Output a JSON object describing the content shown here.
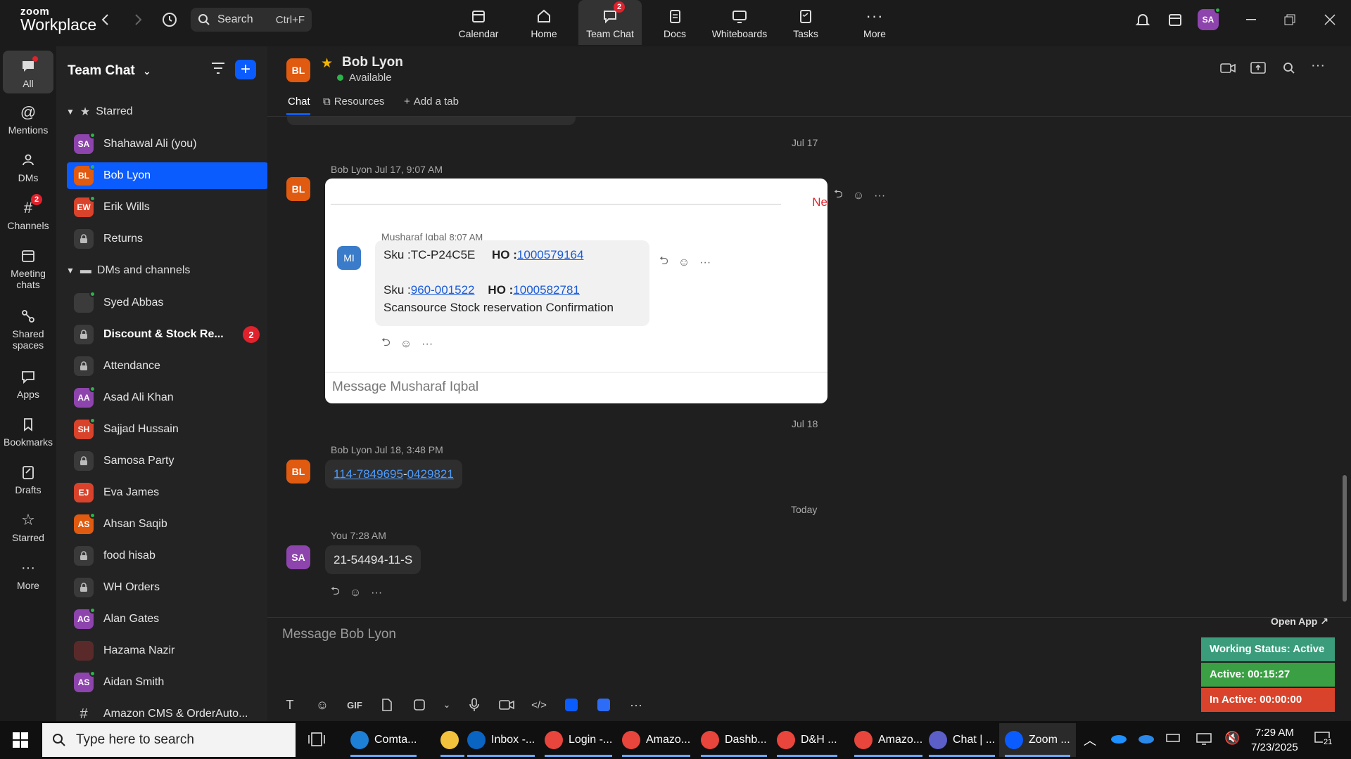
{
  "app": {
    "logo_top": "zoom",
    "logo_bottom": "Workplace"
  },
  "search": {
    "label": "Search",
    "shortcut": "Ctrl+F"
  },
  "topnav": [
    {
      "label": "Calendar",
      "icon": "calendar-icon"
    },
    {
      "label": "Home",
      "icon": "home-icon"
    },
    {
      "label": "Team Chat",
      "icon": "chat-icon",
      "badge": "2",
      "active": true
    },
    {
      "label": "Docs",
      "icon": "docs-icon"
    },
    {
      "label": "Whiteboards",
      "icon": "whiteboard-icon"
    },
    {
      "label": "Tasks",
      "icon": "tasks-icon"
    },
    {
      "label": "More",
      "icon": "more-icon"
    }
  ],
  "user_avatar": "SA",
  "rail": [
    {
      "label": "All",
      "icon": "chat-bubble-icon",
      "active": true
    },
    {
      "label": "Mentions",
      "icon": "at-icon"
    },
    {
      "label": "DMs",
      "icon": "people-icon"
    },
    {
      "label": "Channels",
      "icon": "hash-icon",
      "badge": "2"
    },
    {
      "label": "Meeting chats",
      "icon": "calendar-icon"
    },
    {
      "label": "Shared spaces",
      "icon": "shared-icon"
    },
    {
      "label": "Apps",
      "icon": "apps-icon"
    },
    {
      "label": "Bookmarks",
      "icon": "bookmark-icon"
    },
    {
      "label": "Drafts",
      "icon": "draft-icon"
    },
    {
      "label": "Starred",
      "icon": "star-icon"
    },
    {
      "label": "More",
      "icon": "more-icon"
    }
  ],
  "sidebar": {
    "title": "Team Chat",
    "starred_label": "Starred",
    "dms_label": "DMs and channels",
    "starred": [
      {
        "initials": "SA",
        "name": "Shahawal Ali (you)",
        "color": "#8e44ad",
        "online": true
      },
      {
        "initials": "BL",
        "name": "Bob Lyon",
        "color": "#e05a10",
        "online": true,
        "selected": true
      },
      {
        "initials": "EW",
        "name": "Erik Wills",
        "color": "#d9432b",
        "online": true
      },
      {
        "lock": true,
        "name": "Returns"
      }
    ],
    "items": [
      {
        "initials": "",
        "name": "Syed Abbas",
        "color": "#3b3b3b",
        "online": true,
        "photo": true
      },
      {
        "lock": true,
        "name": "Discount & Stock Re...",
        "bold": true,
        "badge": "2"
      },
      {
        "lock": true,
        "name": "Attendance"
      },
      {
        "initials": "AA",
        "name": "Asad Ali Khan",
        "color": "#8e44ad",
        "online": true
      },
      {
        "initials": "SH",
        "name": "Sajjad Hussain",
        "color": "#d9432b",
        "online": true
      },
      {
        "lock": true,
        "name": "Samosa Party"
      },
      {
        "initials": "EJ",
        "name": "Eva James",
        "color": "#d9432b"
      },
      {
        "initials": "AS",
        "name": "Ahsan Saqib",
        "color": "#e05a10",
        "online": true
      },
      {
        "lock": true,
        "name": "food hisab"
      },
      {
        "lock": true,
        "name": "WH Orders"
      },
      {
        "initials": "AG",
        "name": "Alan Gates",
        "color": "#8e44ad",
        "online": true
      },
      {
        "initials": "",
        "name": "Hazama Nazir",
        "color": "#5a2a2a",
        "photo": true
      },
      {
        "initials": "AS",
        "name": "Aidan Smith",
        "color": "#8e44ad",
        "online": true
      },
      {
        "hash": true,
        "name": "Amazon CMS & OrderAuto..."
      }
    ]
  },
  "chat": {
    "header": {
      "initials": "BL",
      "name": "Bob Lyon",
      "status": "Available"
    },
    "tabs": {
      "chat": "Chat",
      "resources": "Resources",
      "add": "Add a tab"
    },
    "date_jul17": "Jul 17",
    "date_jul18": "Jul 18",
    "date_today": "Today",
    "msg1": {
      "meta": "Bob Lyon Jul 17, 9:07 AM",
      "avatar": "BL",
      "card": {
        "new_label": "Ne",
        "inner_meta_name": "Musharaf Iqbal",
        "inner_meta_time": "8:07 AM",
        "avatar": "MI",
        "sku1_label": "Sku :TC-P24C5E",
        "ho_label": "HO :",
        "ho1": "1000579164",
        "sku2_prefix": "Sku :",
        "sku2": "960-001522",
        "ho2": "1000582781",
        "line3": "Scansource Stock reservation Confirmation",
        "placeholder": "Message Musharaf Iqbal"
      }
    },
    "msg2": {
      "meta": "Bob Lyon Jul 18, 3:48 PM",
      "avatar": "BL",
      "link_a": "114-7849695",
      "dash": "-",
      "link_b": "0429821"
    },
    "msg3": {
      "meta": "You 7:28 AM",
      "avatar": "SA",
      "text": "21-54494-11-S"
    },
    "compose_placeholder": "Message Bob Lyon",
    "toolbar_gif": "GIF"
  },
  "status_widget": {
    "open_app": "Open App ↗",
    "working": "Working Status: Active",
    "active": "Active: 00:15:27",
    "inactive": "In Active: 00:00:00",
    "colors": {
      "working": "#3a9c7a",
      "active": "#3aa043",
      "inactive": "#d9432b"
    }
  },
  "taskbar": {
    "search_placeholder": "Type here to search",
    "apps": [
      {
        "label": "Comta...",
        "color": "#1e7fd6"
      },
      {
        "label": "",
        "color": "#f2c23c"
      },
      {
        "label": "Inbox -...",
        "color": "#0a64c2"
      },
      {
        "label": "Login -...",
        "color": "#e8453c"
      },
      {
        "label": "Amazo...",
        "color": "#e8453c"
      },
      {
        "label": "Dashb...",
        "color": "#e8453c"
      },
      {
        "label": "D&H ...",
        "color": "#e8453c"
      },
      {
        "label": "Amazo...",
        "color": "#e8453c"
      },
      {
        "label": "Chat | ...",
        "color": "#5b5fc7"
      },
      {
        "label": "Zoom ...",
        "color": "#0b5cff",
        "active": true
      }
    ],
    "time": "7:29 AM",
    "date": "7/23/2025",
    "notif_count": "21"
  }
}
